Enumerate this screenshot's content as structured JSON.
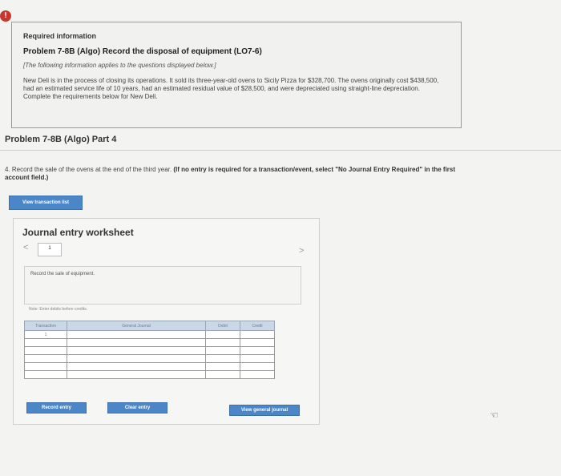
{
  "alert_icon": "!",
  "info": {
    "heading": "Required information",
    "problem": "Problem 7-8B (Algo) Record the disposal of equipment (LO7-6)",
    "note": "[The following information applies to the questions displayed below.]",
    "body": "New Deli is in the process of closing its operations. It sold its three-year-old ovens to Sicily Pizza for $328,700. The ovens originally cost $438,500, had an estimated service life of 10 years, had an estimated residual value of $28,500, and were depreciated using straight-line depreciation. Complete the requirements below for New Deli."
  },
  "part_title": "Problem 7-8B (Algo) Part 4",
  "question": {
    "text": "4. Record the sale of the ovens at the end of the third year.",
    "bold": "(If no entry is required for a transaction/event, select \"No Journal Entry Required\" in the first account field.)"
  },
  "buttons": {
    "view_transaction_list": "View transaction list",
    "record_entry": "Record entry",
    "clear_entry": "Clear entry",
    "view_general_journal": "View general journal"
  },
  "worksheet": {
    "title": "Journal entry worksheet",
    "page": "1",
    "prev_icon": "<",
    "next_icon": ">",
    "description": "Record the sale of equipment.",
    "note": "Note: Enter debits before credits.",
    "columns": [
      "Transaction",
      "General Journal",
      "Debit",
      "Credit"
    ],
    "transaction_number": "1"
  }
}
